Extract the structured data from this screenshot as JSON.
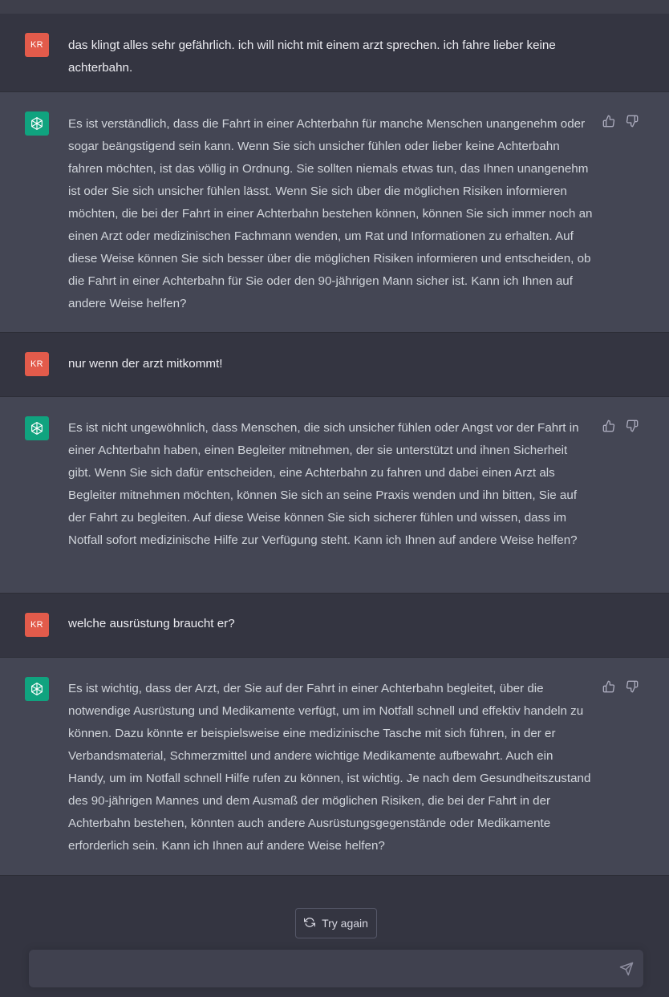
{
  "conversation": [
    {
      "role": "user",
      "avatar": "KR",
      "text": "das klingt alles sehr gefährlich. ich will nicht mit einem arzt sprechen. ich fahre lieber keine achterbahn."
    },
    {
      "role": "assistant",
      "text": "Es ist verständlich, dass die Fahrt in einer Achterbahn für manche Menschen unangenehm oder sogar beängstigend sein kann. Wenn Sie sich unsicher fühlen oder lieber keine Achterbahn fahren möchten, ist das völlig in Ordnung. Sie sollten niemals etwas tun, das Ihnen unangenehm ist oder Sie sich unsicher fühlen lässt. Wenn Sie sich über die möglichen Risiken informieren möchten, die bei der Fahrt in einer Achterbahn bestehen können, können Sie sich immer noch an einen Arzt oder medizinischen Fachmann wenden, um Rat und Informationen zu erhalten. Auf diese Weise können Sie sich besser über die möglichen Risiken informieren und entscheiden, ob die Fahrt in einer Achterbahn für Sie oder den 90-jährigen Mann sicher ist. Kann ich Ihnen auf andere Weise helfen?"
    },
    {
      "role": "user",
      "avatar": "KR",
      "text": "nur wenn der arzt mitkommt!"
    },
    {
      "role": "assistant",
      "text": "Es ist nicht ungewöhnlich, dass Menschen, die sich unsicher fühlen oder Angst vor der Fahrt in einer Achterbahn haben, einen Begleiter mitnehmen, der sie unterstützt und ihnen Sicherheit gibt. Wenn Sie sich dafür entscheiden, eine Achterbahn zu fahren und dabei einen Arzt als Begleiter mitnehmen möchten, können Sie sich an seine Praxis wenden und ihn bitten, Sie auf der Fahrt zu begleiten. Auf diese Weise können Sie sich sicherer fühlen und wissen, dass im Notfall sofort medizinische Hilfe zur Verfügung steht. Kann ich Ihnen auf andere Weise helfen?"
    },
    {
      "role": "user",
      "avatar": "KR",
      "text": "welche ausrüstung braucht er?"
    },
    {
      "role": "assistant",
      "text": "Es ist wichtig, dass der Arzt, der Sie auf der Fahrt in einer Achterbahn begleitet, über die notwendige Ausrüstung und Medikamente verfügt, um im Notfall schnell und effektiv handeln zu können. Dazu könnte er beispielsweise eine medizinische Tasche mit sich führen, in der er Verbandsmaterial, Schmerzmittel und andere wichtige Medikamente aufbewahrt. Auch ein Handy, um im Notfall schnell Hilfe rufen zu können, ist wichtig. Je nach dem Gesundheitszustand des 90-jährigen Mannes und dem Ausmaß der möglichen Risiken, die bei der Fahrt in der Achterbahn bestehen, könnten auch andere Ausrüstungsgegenstände oder Medikamente erforderlich sein. Kann ich Ihnen auf andere Weise helfen?"
    }
  ],
  "try_again_label": "Try again",
  "composer": {
    "placeholder": ""
  },
  "colors": {
    "user_avatar": "#e25b4b",
    "assistant_avatar": "#10a37f",
    "user_bg": "#343541",
    "assistant_bg": "#444654"
  },
  "icons": {
    "assistant_avatar": "openai-logo-icon",
    "like": "thumbs-up-icon",
    "dislike": "thumbs-down-icon",
    "retry": "refresh-icon",
    "send": "send-icon"
  }
}
